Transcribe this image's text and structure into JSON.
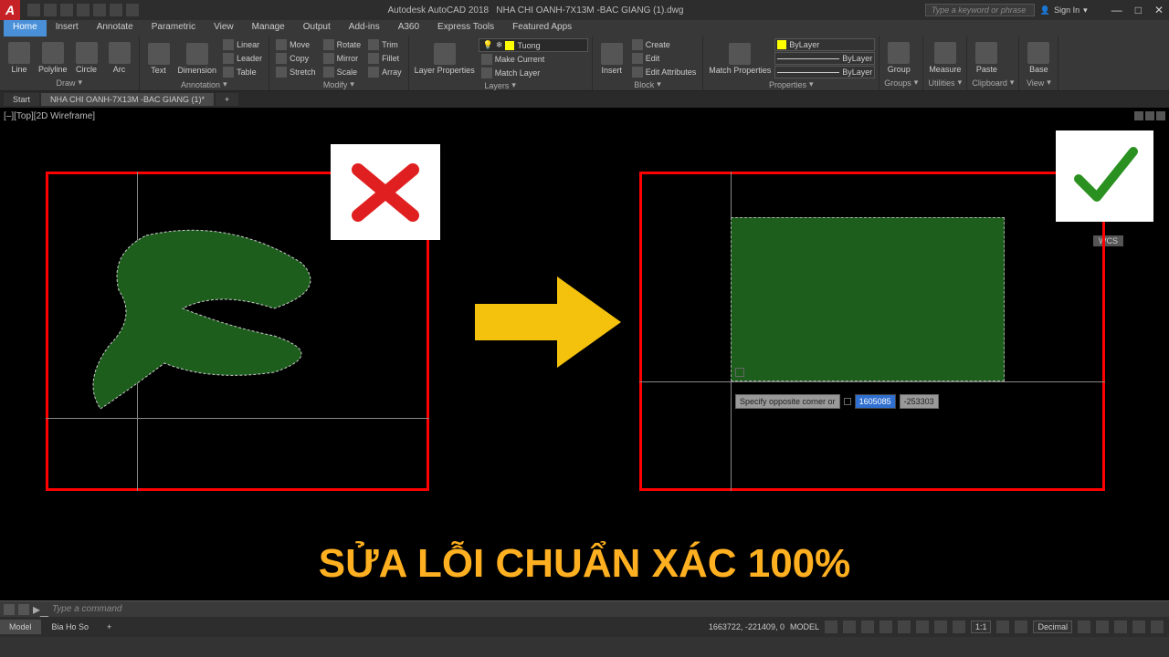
{
  "title": {
    "app": "Autodesk AutoCAD 2018",
    "file": "NHA CHI OANH-7X13M -BAC GIANG (1).dwg"
  },
  "search_placeholder": "Type a keyword or phrase",
  "signin": "Sign In",
  "menu": [
    "Home",
    "Insert",
    "Annotate",
    "Parametric",
    "View",
    "Manage",
    "Output",
    "Add-ins",
    "A360",
    "Express Tools",
    "Featured Apps"
  ],
  "ribbon": {
    "draw": {
      "title": "Draw",
      "items": [
        "Line",
        "Polyline",
        "Circle",
        "Arc"
      ]
    },
    "annotation": {
      "title": "Annotation",
      "items": [
        "Text",
        "Dimension"
      ],
      "sub": [
        "Linear",
        "Leader",
        "Table"
      ]
    },
    "modify": {
      "title": "Modify",
      "rows": [
        [
          "Move",
          "Rotate",
          "Trim"
        ],
        [
          "Copy",
          "Mirror",
          "Fillet"
        ],
        [
          "Stretch",
          "Scale",
          "Array"
        ]
      ]
    },
    "layers": {
      "title": "Layers",
      "btn": "Layer Properties",
      "current": "Tuong",
      "sub": [
        "Make Current",
        "Match Layer"
      ]
    },
    "block": {
      "title": "Block",
      "btn": "Insert",
      "sub": [
        "Create",
        "Edit",
        "Edit Attributes"
      ]
    },
    "properties": {
      "title": "Properties",
      "btn": "Match Properties",
      "bylayer": "ByLayer"
    },
    "groups": {
      "title": "Groups",
      "btn": "Group"
    },
    "utilities": {
      "title": "Utilities",
      "btn": "Measure"
    },
    "clipboard": {
      "title": "Clipboard",
      "btn": "Paste"
    },
    "view": {
      "title": "View",
      "btn": "Base"
    }
  },
  "doctabs": {
    "start": "Start",
    "file": "NHA CHI OANH-7X13M -BAC GIANG (1)*"
  },
  "viewport": {
    "label": "[–][Top][2D Wireframe]",
    "wcs": "WCS"
  },
  "dyn": {
    "prompt": "Specify opposite corner or",
    "v1": "1605085",
    "v2": "-253303"
  },
  "headline": "SỬA LỖI CHUẨN XÁC 100%",
  "cmd_placeholder": "Type a command",
  "status": {
    "model": "Model",
    "layout": "Bia Ho So",
    "coords": "1663722, -221409, 0",
    "model_btn": "MODEL",
    "scale": "1:1",
    "units": "Decimal"
  }
}
